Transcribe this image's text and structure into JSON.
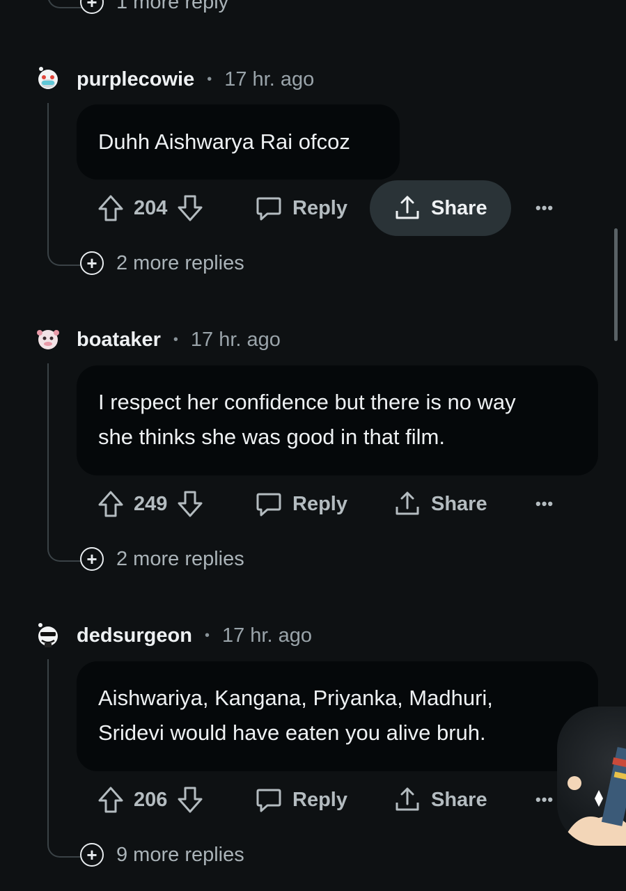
{
  "top_more": {
    "label": "1 more reply"
  },
  "comments": [
    {
      "username": "purplecowie",
      "separator": "•",
      "time": "17 hr. ago",
      "lines": [
        "Duhh Aishwarya Rai ofcoz"
      ],
      "votes": "204",
      "reply_label": "Reply",
      "share_label": "Share",
      "more_label": "•••",
      "more_replies": "2 more replies"
    },
    {
      "username": "boataker",
      "separator": "•",
      "time": "17 hr. ago",
      "lines": [
        "I respect her confidence but there is no way",
        "she thinks she was good in that film."
      ],
      "votes": "249",
      "reply_label": "Reply",
      "share_label": "Share",
      "more_label": "•••",
      "more_replies": "2 more replies"
    },
    {
      "username": "dedsurgeon",
      "separator": "•",
      "time": "17 hr. ago",
      "lines": [
        "Aishwariya, Kangana, Priyanka, Madhuri,",
        "Sridevi would have eaten you alive bruh."
      ],
      "votes": "206",
      "reply_label": "Reply",
      "share_label": "Share",
      "more_label": "•••",
      "more_replies": "9 more replies"
    }
  ],
  "icons": {
    "upvote": "upvote-icon",
    "downvote": "downvote-icon",
    "reply": "comment-bubble-icon",
    "share": "share-upload-icon",
    "expand": "plus-circle-icon",
    "overflow": "ellipsis-icon"
  },
  "colors": {
    "background": "#0e1113",
    "bubble": "#05080a",
    "share_pill": "#2a3337",
    "thread_line": "#3a4246"
  }
}
